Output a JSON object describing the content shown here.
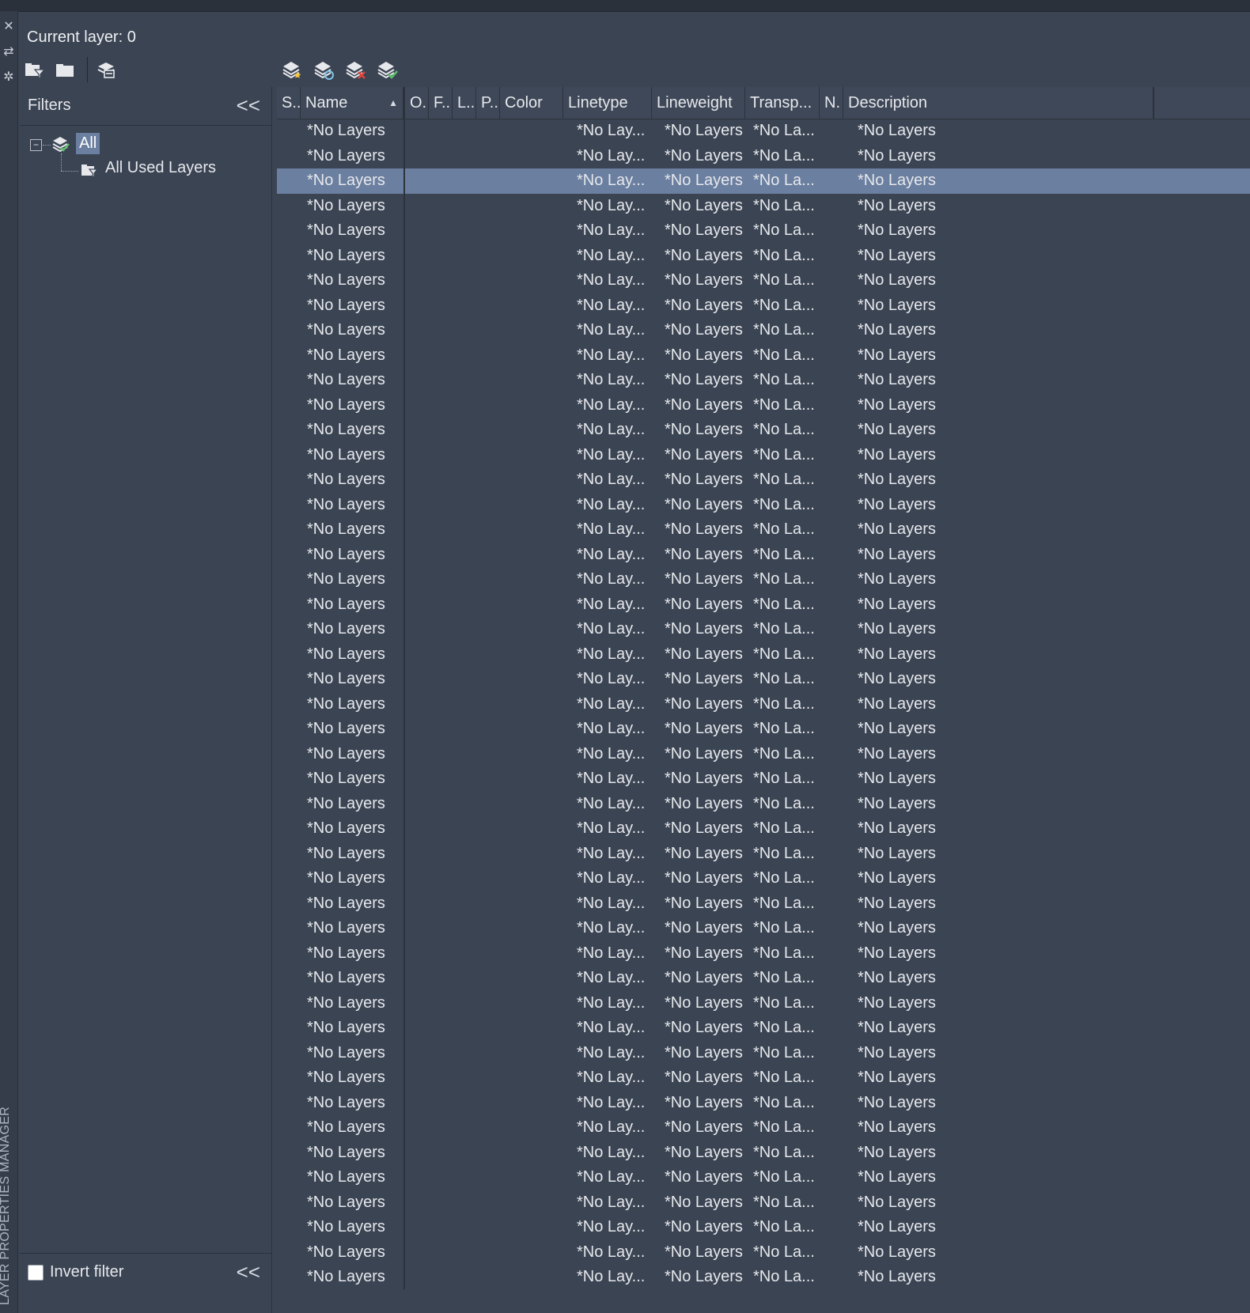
{
  "panel": {
    "current_layer": "Current layer: 0",
    "side_title": "LAYER PROPERTIES MANAGER"
  },
  "filters": {
    "title": "Filters",
    "collapse": "<<",
    "tree": {
      "all": "All",
      "used": "All Used Layers"
    },
    "invert_label": "Invert filter",
    "invert_checked": false
  },
  "grid": {
    "columns": [
      "S..",
      "Name",
      "O.",
      "F..",
      "L..",
      "P..",
      "Color",
      "Linetype",
      "Lineweight",
      "Transp...",
      "N.",
      "Description"
    ],
    "sort_indicator": "▲",
    "placeholder": {
      "name": "*No Layers",
      "linetype": "*No Lay...",
      "lineweight": "*No Layers",
      "transparency": "*No La...",
      "description": "*No Layers"
    },
    "row_count": 47,
    "selected_row": 2
  },
  "colors": {
    "background": "#3b4453",
    "selection": "#6b7fa0",
    "header": "#3f4858"
  }
}
